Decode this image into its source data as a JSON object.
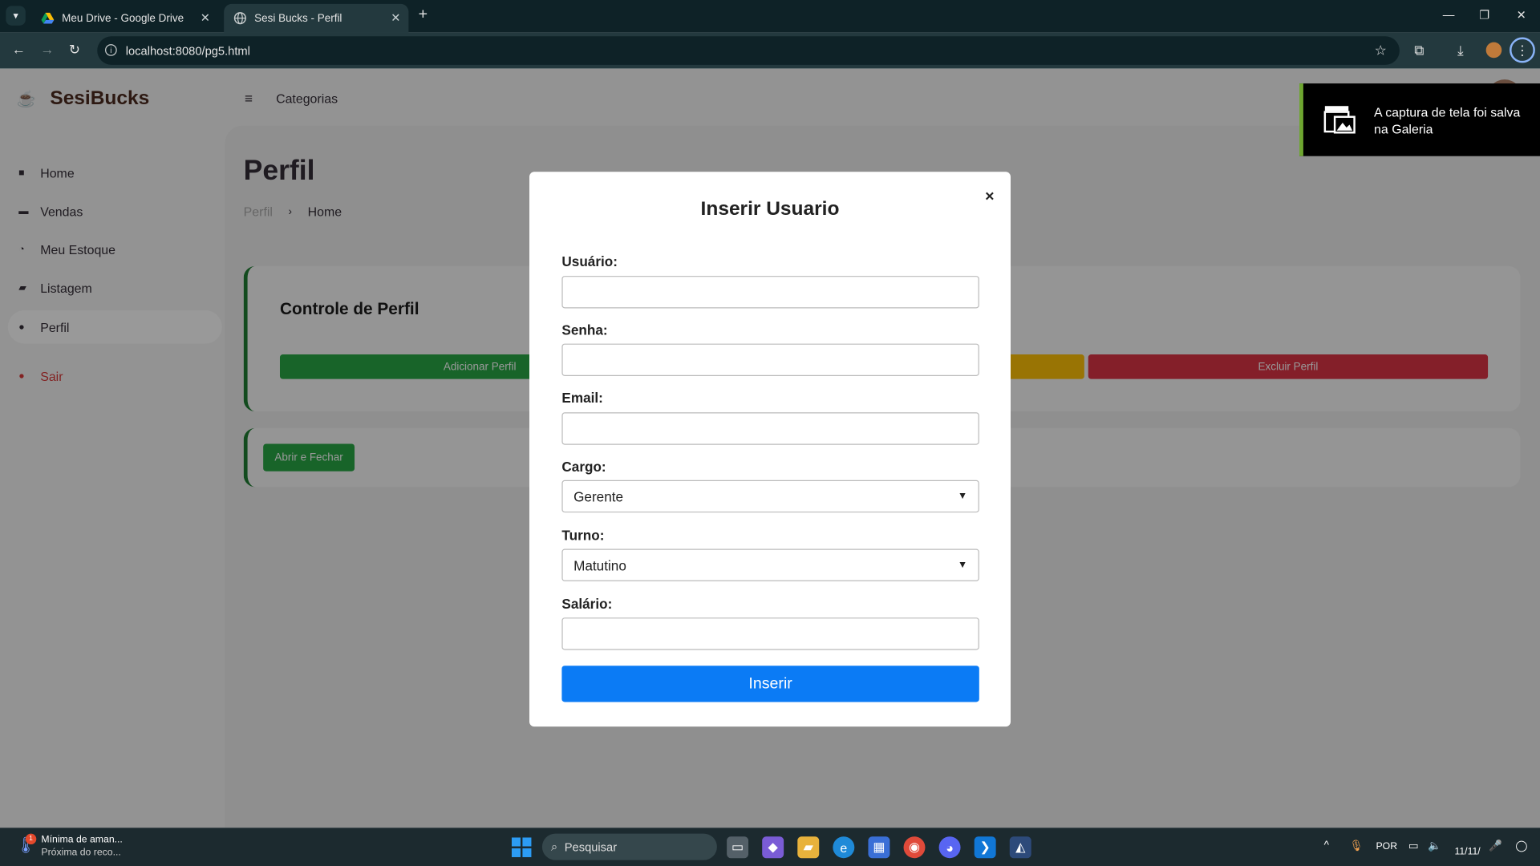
{
  "browser": {
    "tabs": [
      {
        "label": "Meu Drive - Google Drive",
        "active": false
      },
      {
        "label": "Sesi Bucks - Perfil",
        "active": true
      }
    ],
    "url": "localhost:8080/pg5.html"
  },
  "sidebar": {
    "brand": "SesiBucks",
    "items": [
      {
        "label": "Home",
        "icon": "dashboard-icon"
      },
      {
        "label": "Vendas",
        "icon": "store-icon"
      },
      {
        "label": "Meu Estoque",
        "icon": "pie-chart-icon"
      },
      {
        "label": "Listagem",
        "icon": "message-icon"
      },
      {
        "label": "Perfil",
        "icon": "user-icon",
        "active": true
      }
    ],
    "logout": "Sair"
  },
  "topnav": {
    "menu_label": "Categorias"
  },
  "main": {
    "title": "Perfil",
    "breadcrumb": [
      "Perfil",
      "Home"
    ],
    "card": {
      "title": "Controle de Perfil",
      "buttons": {
        "add": "Adicionar Perfil",
        "edit": "",
        "delete": "Excluir Perfil"
      }
    },
    "open_close_button": "Abrir e Fechar"
  },
  "modal": {
    "title": "Inserir Usuario",
    "close": "×",
    "fields": {
      "usuario": {
        "label": "Usuário:",
        "value": ""
      },
      "senha": {
        "label": "Senha:",
        "value": ""
      },
      "email": {
        "label": "Email:",
        "value": ""
      },
      "cargo": {
        "label": "Cargo:",
        "value": "Gerente"
      },
      "turno": {
        "label": "Turno:",
        "value": "Matutino"
      },
      "salario": {
        "label": "Salário:",
        "value": ""
      }
    },
    "submit": "Inserir"
  },
  "toast": {
    "text": "A captura de tela foi salva na Galeria"
  },
  "taskbar": {
    "weather_title": "Mínima de aman...",
    "weather_sub": "Próxima do reco...",
    "weather_badge": "1",
    "search_placeholder": "Pesquisar",
    "language": "POR",
    "date": "11/11/"
  },
  "colors": {
    "brand": "#4c2a1e",
    "accent_green": "#28a745",
    "warning_yellow": "#ffc107",
    "danger_red": "#dc3545",
    "primary_blue": "#0b7bf5"
  }
}
